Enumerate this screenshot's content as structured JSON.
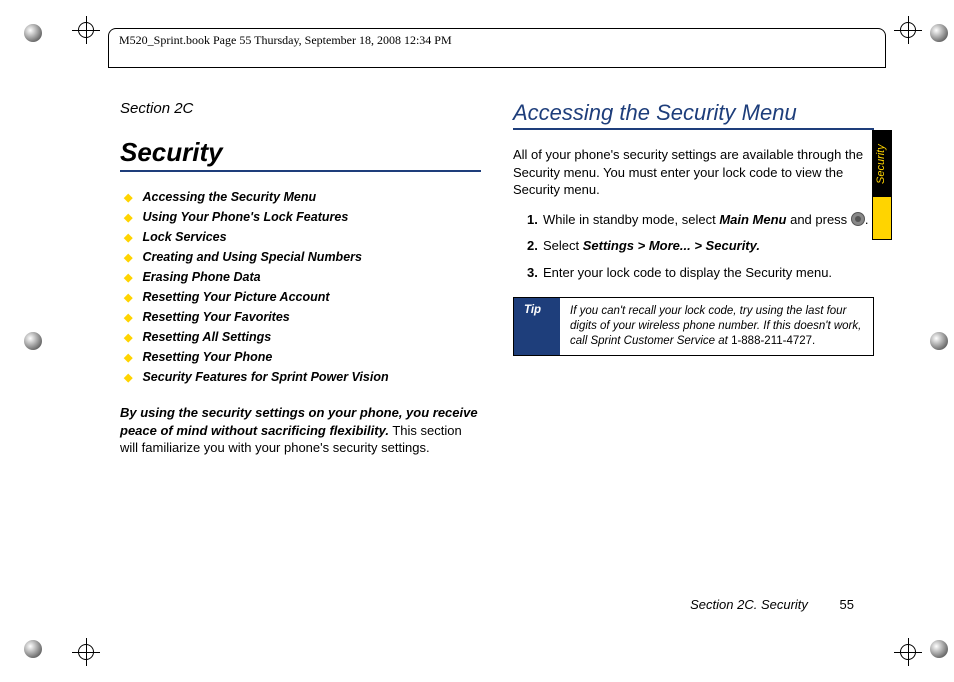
{
  "frame": {
    "header_text": "M520_Sprint.book  Page 55  Thursday, September 18, 2008  12:34 PM"
  },
  "left": {
    "section_label": "Section 2C",
    "title": "Security",
    "toc": [
      "Accessing the Security Menu",
      "Using Your Phone's Lock Features",
      "Lock Services",
      "Creating and Using Special Numbers",
      "Erasing Phone Data",
      "Resetting Your Picture Account",
      "Resetting Your Favorites",
      "Resetting All Settings",
      "Resetting Your Phone",
      "Security Features for Sprint Power Vision"
    ],
    "intro_lead": "By using the security settings on your phone, you receive peace of mind without sacrificing flexibility.",
    "intro_rest": " This section will familiarize you with your phone's security settings."
  },
  "right": {
    "heading": "Accessing the Security Menu",
    "para": "All of your phone's security settings are available through the Security menu. You must enter your lock code to view the Security menu.",
    "step1_a": "While in standby mode, select ",
    "step1_b": "Main Menu",
    "step1_c": " and press ",
    "step1_d": ".",
    "step2_a": "Select ",
    "step2_b": "Settings > More... > Security.",
    "step3": "Enter your lock code to display the Security menu.",
    "tip_label": "Tip",
    "tip_body": "If you can't recall your lock code, try using the last four digits of your wireless phone number. If this doesn't work, call Sprint Customer Service at ",
    "tip_phone": "1-888-211-4727."
  },
  "side_tab": "Security",
  "footer": {
    "text": "Section 2C. Security",
    "page": "55"
  }
}
